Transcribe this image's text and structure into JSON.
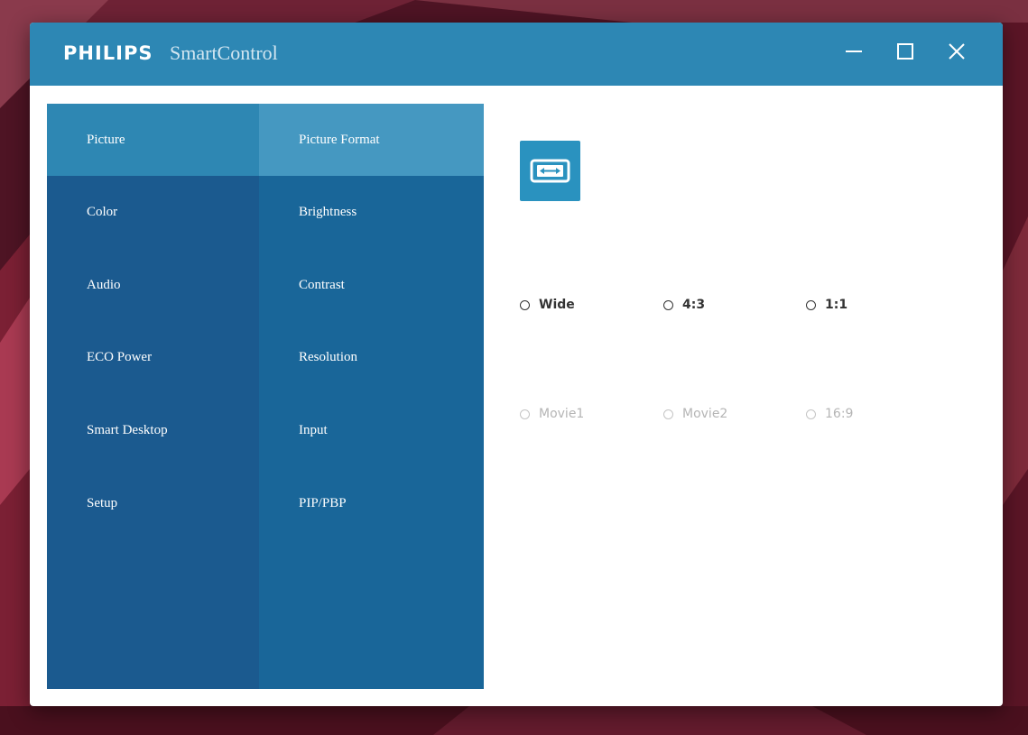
{
  "app": {
    "brand": "PHILIPS",
    "name": "SmartControl"
  },
  "window_controls": {
    "minimize_icon": "minimize-icon",
    "maximize_icon": "maximize-icon",
    "close_icon": "close-icon"
  },
  "menu": {
    "items": [
      {
        "label": "Picture",
        "active": true
      },
      {
        "label": "Color",
        "active": false
      },
      {
        "label": "Audio",
        "active": false
      },
      {
        "label": "ECO Power",
        "active": false
      },
      {
        "label": "Smart Desktop",
        "active": false
      },
      {
        "label": "Setup",
        "active": false
      }
    ]
  },
  "submenu": {
    "items": [
      {
        "label": "Picture Format",
        "active": true
      },
      {
        "label": "Brightness",
        "active": false
      },
      {
        "label": "Contrast",
        "active": false
      },
      {
        "label": "Resolution",
        "active": false
      },
      {
        "label": "Input",
        "active": false
      },
      {
        "label": "PIP/PBP",
        "active": false
      }
    ]
  },
  "content": {
    "icon": "picture-format-icon",
    "options": [
      {
        "label": "Wide",
        "enabled": true
      },
      {
        "label": "4:3",
        "enabled": true
      },
      {
        "label": "1:1",
        "enabled": true
      },
      {
        "label": "Movie1",
        "enabled": false
      },
      {
        "label": "Movie2",
        "enabled": false
      },
      {
        "label": "16:9",
        "enabled": false
      }
    ]
  },
  "colors": {
    "titlebar": "#2d87b4",
    "menu": "#1b5a8f",
    "submenu": "#196699",
    "menu_active": "#2e87b3",
    "submenu_active": "#4598c1",
    "icon_tile": "#2a92bf"
  }
}
